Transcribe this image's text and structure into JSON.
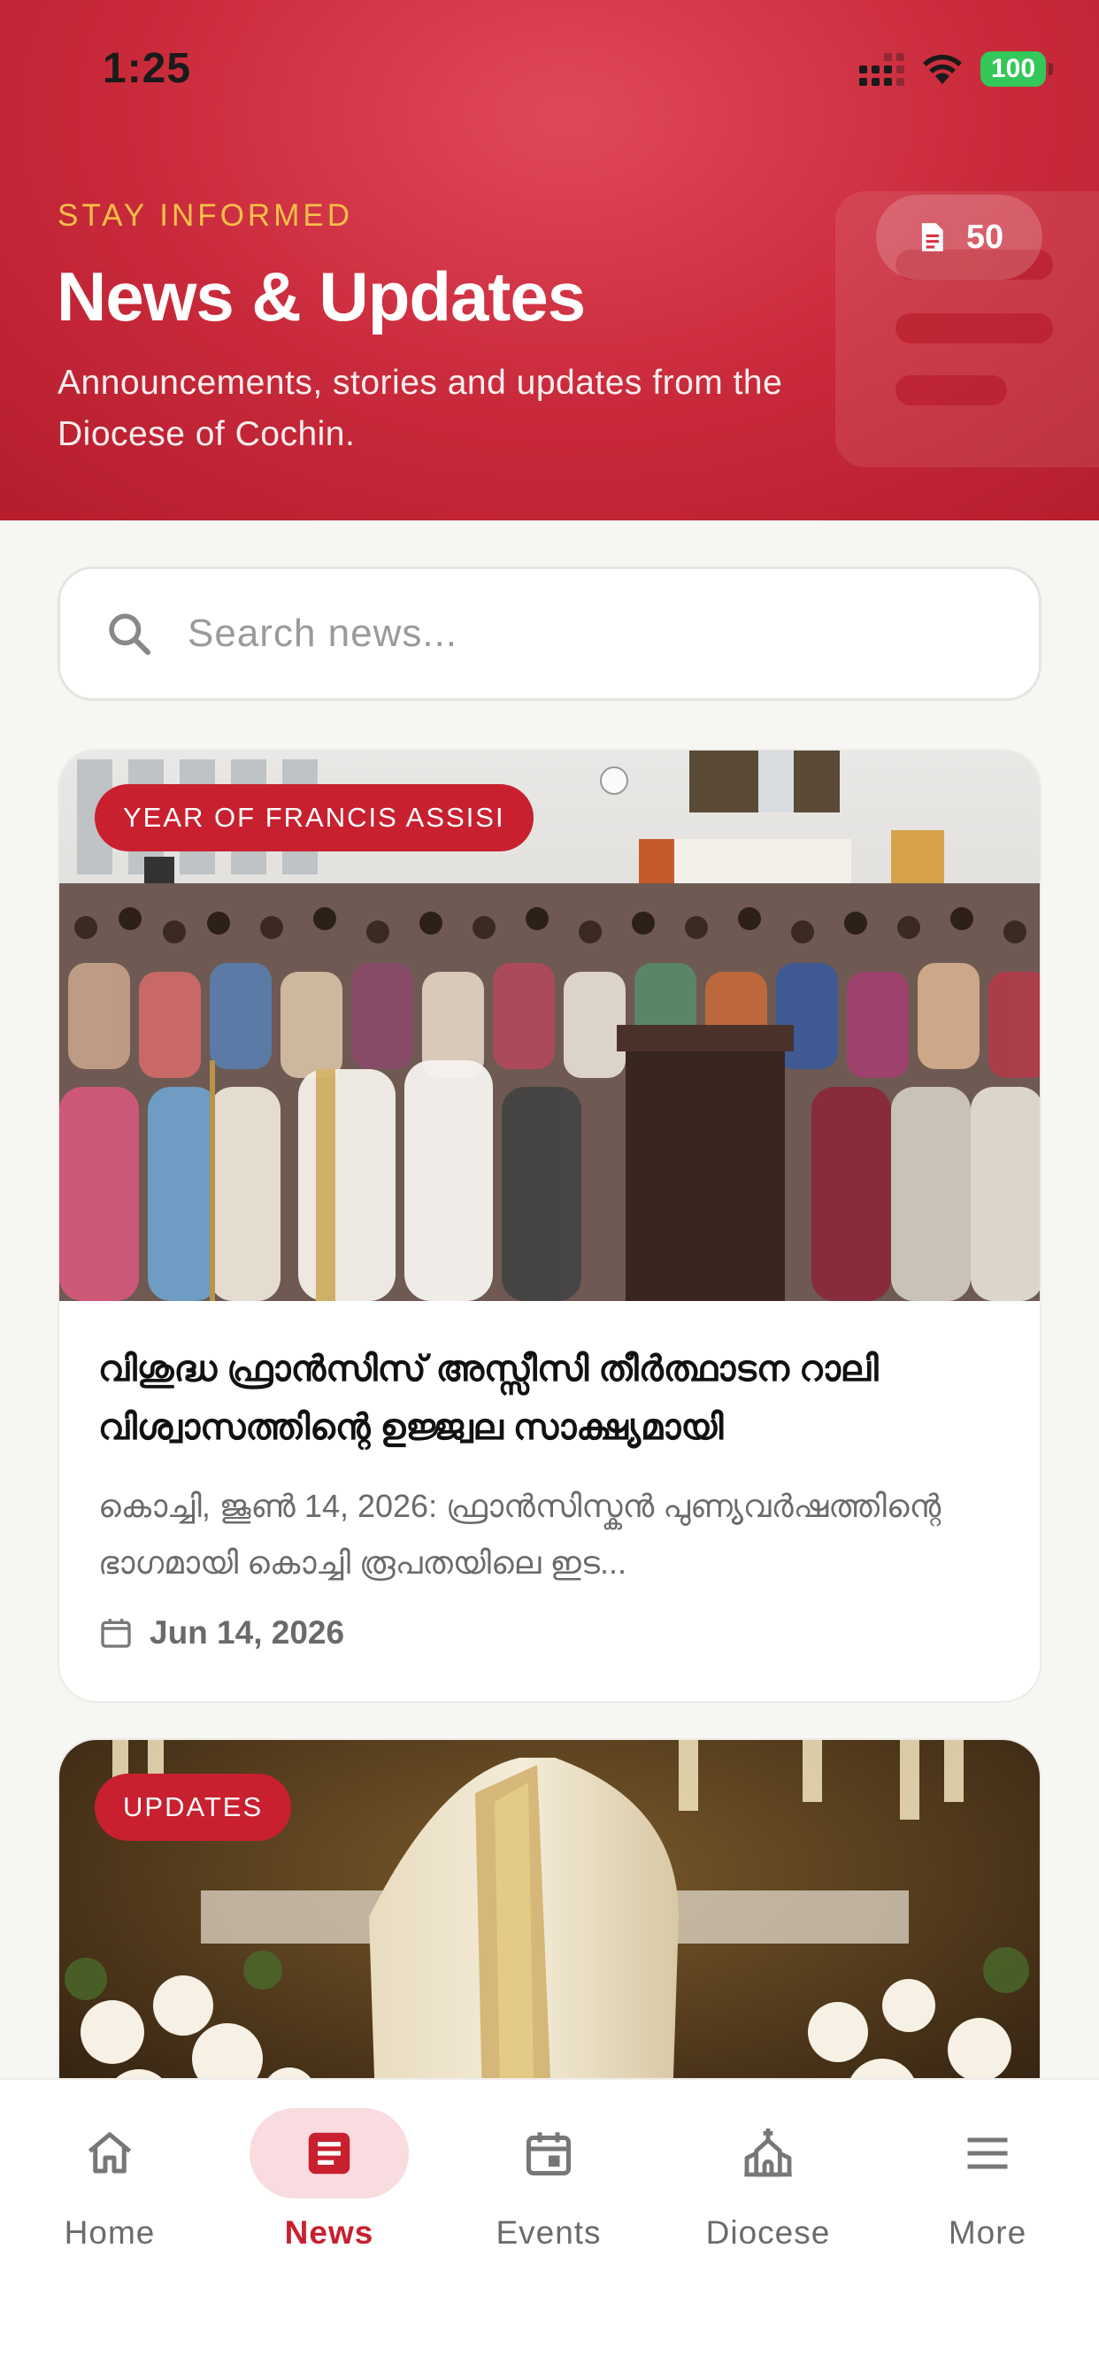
{
  "status_bar": {
    "time": "1:25",
    "battery": "100"
  },
  "header": {
    "eyebrow": "STAY INFORMED",
    "title": "News & Updates",
    "subtitle": "Announcements, stories and updates from the Diocese of Cochin.",
    "count": "50",
    "colors": {
      "background": "#c92a3b",
      "eyebrow": "#f5c047"
    }
  },
  "search": {
    "placeholder": "Search news...",
    "value": ""
  },
  "articles": [
    {
      "badge": "YEAR OF FRANCIS ASSISI",
      "title": "വിശുദ്ധ ഫ്രാൻസിസ് അസ്സീസി തീർത്ഥാടന റാലി വിശ്വാസത്തിന്റെ ഉജ്ജ്വല സാക്ഷ്യമായി",
      "excerpt": "കൊച്ചി, ജൂൺ 14, 2026: ഫ്രാൻസിസ്കൻ പുണ്യവർഷത്തിന്റെ ഭാഗമായി കൊച്ചി രൂപതയിലെ ഇട...",
      "date": "Jun 14, 2026",
      "image": "church-crowd-photo"
    },
    {
      "badge": "UPDATES",
      "image": "bishop-mitre-photo"
    }
  ],
  "tabbar": {
    "active": "News",
    "items": [
      {
        "label": "Home",
        "icon": "home-icon"
      },
      {
        "label": "News",
        "icon": "news-icon"
      },
      {
        "label": "Events",
        "icon": "calendar-icon"
      },
      {
        "label": "Diocese",
        "icon": "church-icon"
      },
      {
        "label": "More",
        "icon": "menu-icon"
      }
    ]
  },
  "colors": {
    "accent": "#c8202f",
    "background": "#f7f6f3"
  }
}
